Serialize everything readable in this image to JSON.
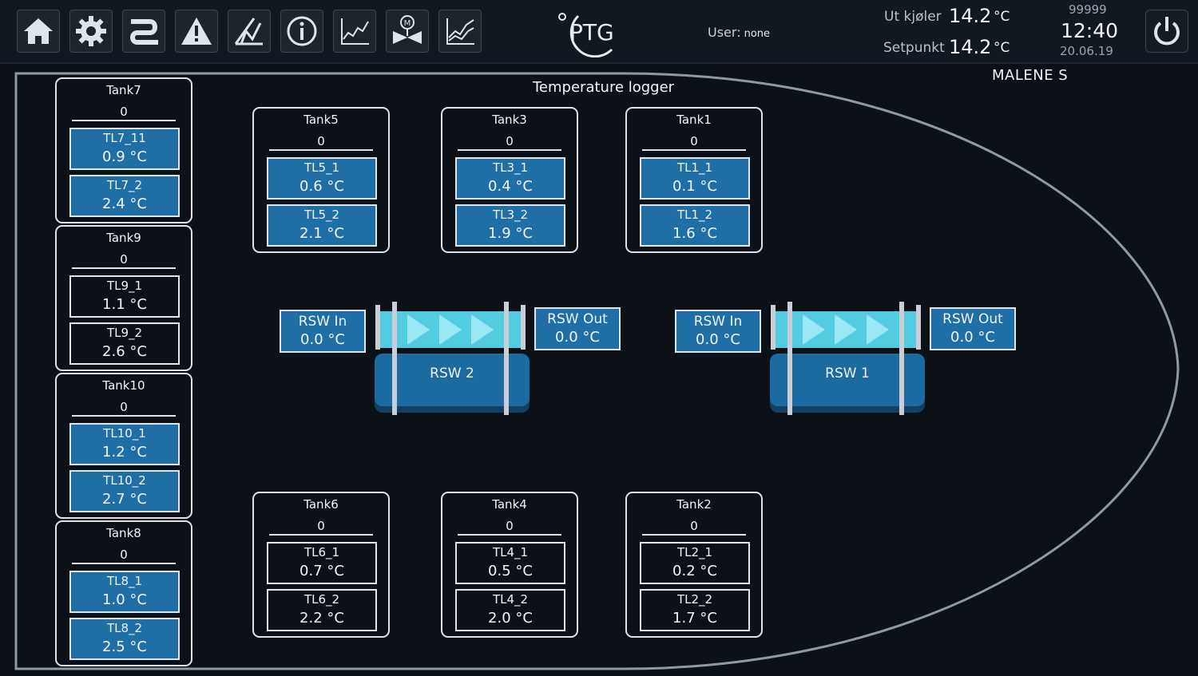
{
  "header": {
    "logo_text": "PTG",
    "user_label": "User:",
    "user_value": "none",
    "ut_kjoler_label": "Ut kjøler",
    "ut_kjoler_value": "14.2",
    "setpunkt_label": "Setpunkt",
    "setpunkt_value": "14.2",
    "unit": "°C",
    "clock_number": "99999",
    "time": "12:40",
    "date": "20.06.19"
  },
  "toolbar": [
    "home-icon",
    "gear-icon",
    "pipe-icon",
    "warning-icon",
    "calibration-icon",
    "info-icon",
    "trend-icon",
    "motor-valve-icon",
    "multi-trend-icon"
  ],
  "page_title": "Temperature logger",
  "vessel_name": "MALENE S",
  "tanks": {
    "tank7": {
      "name": "Tank7",
      "count": "0",
      "s1": {
        "name": "TL7_11",
        "value": "0.9 °C"
      },
      "s2": {
        "name": "TL7_2",
        "value": "2.4 °C"
      }
    },
    "tank9": {
      "name": "Tank9",
      "count": "0",
      "s1": {
        "name": "TL9_1",
        "value": "1.1 °C"
      },
      "s2": {
        "name": "TL9_2",
        "value": "2.6 °C"
      }
    },
    "tank10": {
      "name": "Tank10",
      "count": "0",
      "s1": {
        "name": "TL10_1",
        "value": "1.2 °C"
      },
      "s2": {
        "name": "TL10_2",
        "value": "2.7 °C"
      }
    },
    "tank8": {
      "name": "Tank8",
      "count": "0",
      "s1": {
        "name": "TL8_1",
        "value": "1.0 °C"
      },
      "s2": {
        "name": "TL8_2",
        "value": "2.5 °C"
      }
    },
    "tank5": {
      "name": "Tank5",
      "count": "0",
      "s1": {
        "name": "TL5_1",
        "value": "0.6 °C"
      },
      "s2": {
        "name": "TL5_2",
        "value": "2.1 °C"
      }
    },
    "tank3": {
      "name": "Tank3",
      "count": "0",
      "s1": {
        "name": "TL3_1",
        "value": "0.4 °C"
      },
      "s2": {
        "name": "TL3_2",
        "value": "1.9 °C"
      }
    },
    "tank1": {
      "name": "Tank1",
      "count": "0",
      "s1": {
        "name": "TL1_1",
        "value": "0.1 °C"
      },
      "s2": {
        "name": "TL1_2",
        "value": "1.6 °C"
      }
    },
    "tank6": {
      "name": "Tank6",
      "count": "0",
      "s1": {
        "name": "TL6_1",
        "value": "0.7 °C"
      },
      "s2": {
        "name": "TL6_2",
        "value": "2.2 °C"
      }
    },
    "tank4": {
      "name": "Tank4",
      "count": "0",
      "s1": {
        "name": "TL4_1",
        "value": "0.5 °C"
      },
      "s2": {
        "name": "TL4_2",
        "value": "2.0 °C"
      }
    },
    "tank2": {
      "name": "Tank2",
      "count": "0",
      "s1": {
        "name": "TL2_1",
        "value": "0.2 °C"
      },
      "s2": {
        "name": "TL2_2",
        "value": "1.7 °C"
      }
    }
  },
  "rsw2": {
    "name": "RSW 2",
    "in_label": "RSW In",
    "in_value": "0.0 °C",
    "out_label": "RSW Out",
    "out_value": "0.0 °C"
  },
  "rsw1": {
    "name": "RSW 1",
    "in_label": "RSW In",
    "in_value": "0.0 °C",
    "out_label": "RSW Out",
    "out_value": "0.0 °C"
  },
  "colors": {
    "background": "#0c1118",
    "sensor_active": "#1f6ea6",
    "cooler_body": "#1b6aa0",
    "cooler_flow": "#3fc4dc"
  }
}
